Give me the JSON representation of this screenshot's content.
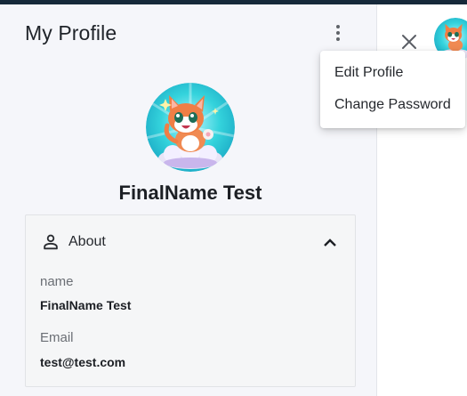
{
  "profile": {
    "title": "My Profile",
    "name": "FinalName Test",
    "menu_icon": "more-vertical-icon",
    "avatar_icon": "cat-on-cloud-avatar"
  },
  "about": {
    "title": "About",
    "icon": "person-icon",
    "expanded": true,
    "fields": [
      {
        "label": "name",
        "value": "FinalName Test"
      },
      {
        "label": "Email",
        "value": "test@test.com"
      }
    ]
  },
  "menu": {
    "items": [
      {
        "label": "Edit Profile"
      },
      {
        "label": "Change Password"
      }
    ]
  },
  "right_panel": {
    "close_icon": "close-icon",
    "avatar_icon": "cat-on-cloud-avatar"
  },
  "colors": {
    "topbar": "#16293a",
    "panel_bg": "#f5f6fa",
    "avatar_ring": "#2ecbd4"
  }
}
